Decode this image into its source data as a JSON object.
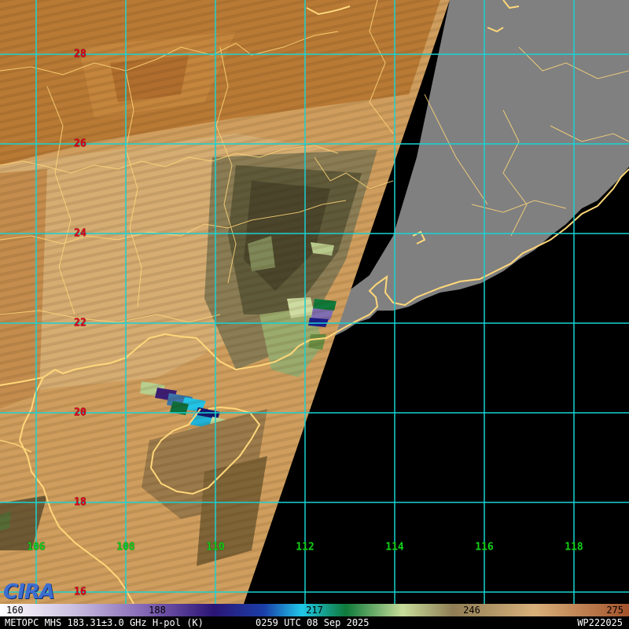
{
  "map": {
    "latitude_labels": [
      "28",
      "26",
      "24",
      "22",
      "20",
      "18",
      "16"
    ],
    "longitude_labels": [
      "106",
      "108",
      "110",
      "112",
      "114",
      "116",
      "118"
    ],
    "no_data_color": "#808080",
    "ocean_color": "#000000",
    "grid_color": "#19d2d2",
    "coastline_color": "#ffd77a"
  },
  "logo": {
    "text": "CIRA",
    "icon": "cira-logo"
  },
  "colorbar": {
    "ticks": [
      "160",
      "188",
      "217",
      "246",
      "275"
    ],
    "colors": [
      "#ffffff",
      "#b3a6d3",
      "#5a2a8f",
      "#1b1b8c",
      "#20c8e8",
      "#0f7a3a",
      "#c7dd9a",
      "#b9a878",
      "#d9b07a",
      "#a3622b"
    ]
  },
  "footer": {
    "left": "METOPC MHS 183.31±3.0 GHz H-pol (K)",
    "center": "0259 UTC 08 Sep 2025",
    "right": "WP222025"
  }
}
